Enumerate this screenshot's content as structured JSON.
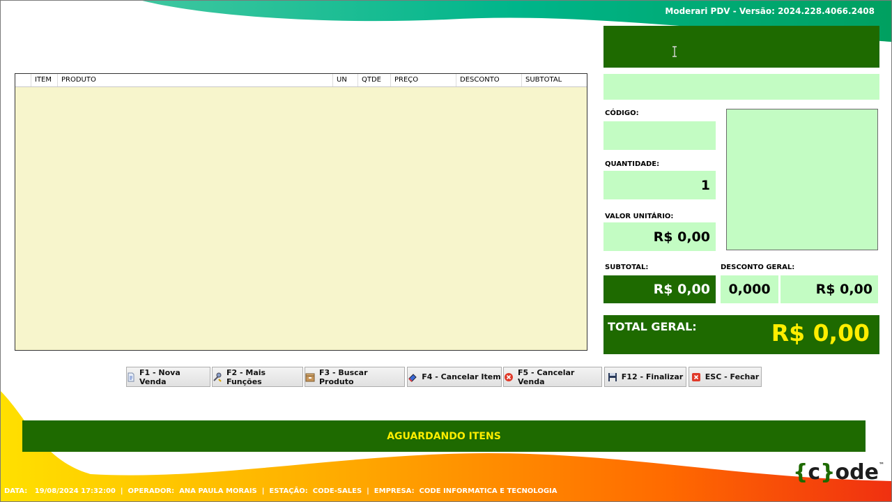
{
  "app": {
    "version_label": "Moderari PDV - Versão: 2024.228.4066.2408"
  },
  "grid": {
    "columns": [
      "",
      "ITEM",
      "PRODUTO",
      "UN",
      "QTDE",
      "PREÇO",
      "DESCONTO",
      "SUBTOTAL"
    ],
    "rows": []
  },
  "panel": {
    "top_display": "",
    "product_display": "",
    "codigo_label": "CÓDIGO:",
    "codigo_value": "",
    "quantidade_label": "QUANTIDADE:",
    "quantidade_value": "1",
    "valor_unitario_label": "VALOR UNITÁRIO:",
    "valor_unitario_value": "R$ 0,00",
    "subtotal_label": "SUBTOTAL:",
    "subtotal_value": "R$ 0,00",
    "desconto_geral_label": "DESCONTO GERAL:",
    "desconto_percent_value": "0,000",
    "desconto_valor_value": "R$ 0,00",
    "total_geral_label": "TOTAL GERAL:",
    "total_geral_value": "R$ 0,00"
  },
  "toolbar": {
    "nova_venda": "F1 - Nova Venda",
    "mais_funcoes": "F2 - Mais Funções",
    "buscar_produto": "F3 - Buscar Produto",
    "cancelar_item": "F4 - Cancelar Item",
    "cancelar_venda": "F5 - Cancelar Venda",
    "finalizar": "F12 - Finalizar",
    "fechar": "ESC - Fechar"
  },
  "status": {
    "message": "AGUARDANDO ITENS"
  },
  "logo": {
    "text_open": "{",
    "text_c": "c",
    "text_close": "}",
    "text_ode": "ode",
    "tm": "™"
  },
  "footer": {
    "data_label": "DATA:",
    "data_value": "19/08/2024 17:32:00",
    "operador_label": "OPERADOR:",
    "operador_value": "ANA PAULA MORAIS",
    "estacao_label": "ESTAÇÃO:",
    "estacao_value": "CODE-SALES",
    "empresa_label": "EMPRESA:",
    "empresa_value": "CODE INFORMATICA E TECNOLOGIA",
    "separator": "|"
  },
  "colors": {
    "dark_green": "#1e6a00",
    "light_green": "#c3fcc3",
    "grid_bg": "#f7f5cc",
    "status_text": "#ffee00",
    "total_value": "#ffee00"
  },
  "icons": {
    "nova_venda": "document-icon",
    "mais_funcoes": "tools-icon",
    "buscar_produto": "box-icon",
    "cancelar_item": "eraser-icon",
    "cancelar_venda": "red-x-circle-icon",
    "finalizar": "floppy-disk-icon",
    "fechar": "red-x-square-icon"
  }
}
